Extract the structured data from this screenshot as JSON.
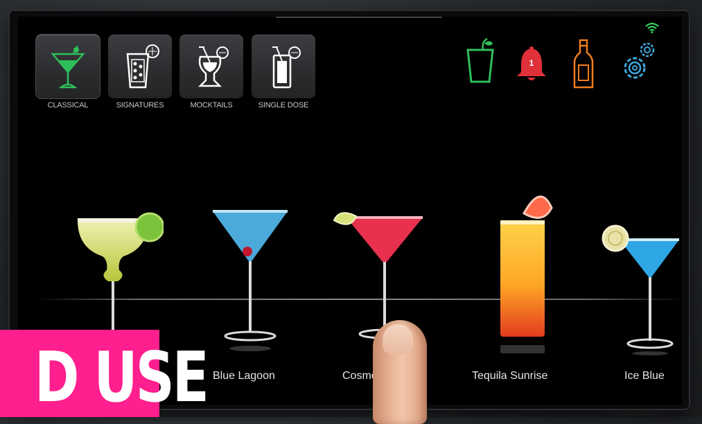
{
  "categories": [
    {
      "label": "CLASSICAL",
      "icon": "martini-glass-icon",
      "active": true
    },
    {
      "label": "SIGNATURES",
      "icon": "ice-glass-icon"
    },
    {
      "label": "MOCKTAILS",
      "icon": "hurricane-glass-icon"
    },
    {
      "label": "SINGLE DOSE",
      "icon": "tall-glass-icon"
    }
  ],
  "status_bar": {
    "wifi_icon": "wifi-icon",
    "glass_icon": "plant-glass-icon",
    "bell_icon": "notification-bell-icon",
    "notification_count": "1",
    "bottle_icon": "bottle-icon",
    "settings_icon": "gears-icon"
  },
  "colors": {
    "glass_green": "#2fbf5a",
    "bell_red": "#e0303a",
    "bottle_orange": "#f07d1e",
    "gears_blue": "#3fa9e0",
    "wifi_green": "#35d05a",
    "banner_pink": "#ff1f8e"
  },
  "drinks": [
    {
      "name": ""
    },
    {
      "name": "Blue Lagoon"
    },
    {
      "name": "Cosmo"
    },
    {
      "name": "Tequila Sunrise"
    },
    {
      "name": "Ice Blue"
    }
  ],
  "overlay": {
    "banner_text": "D USE"
  }
}
